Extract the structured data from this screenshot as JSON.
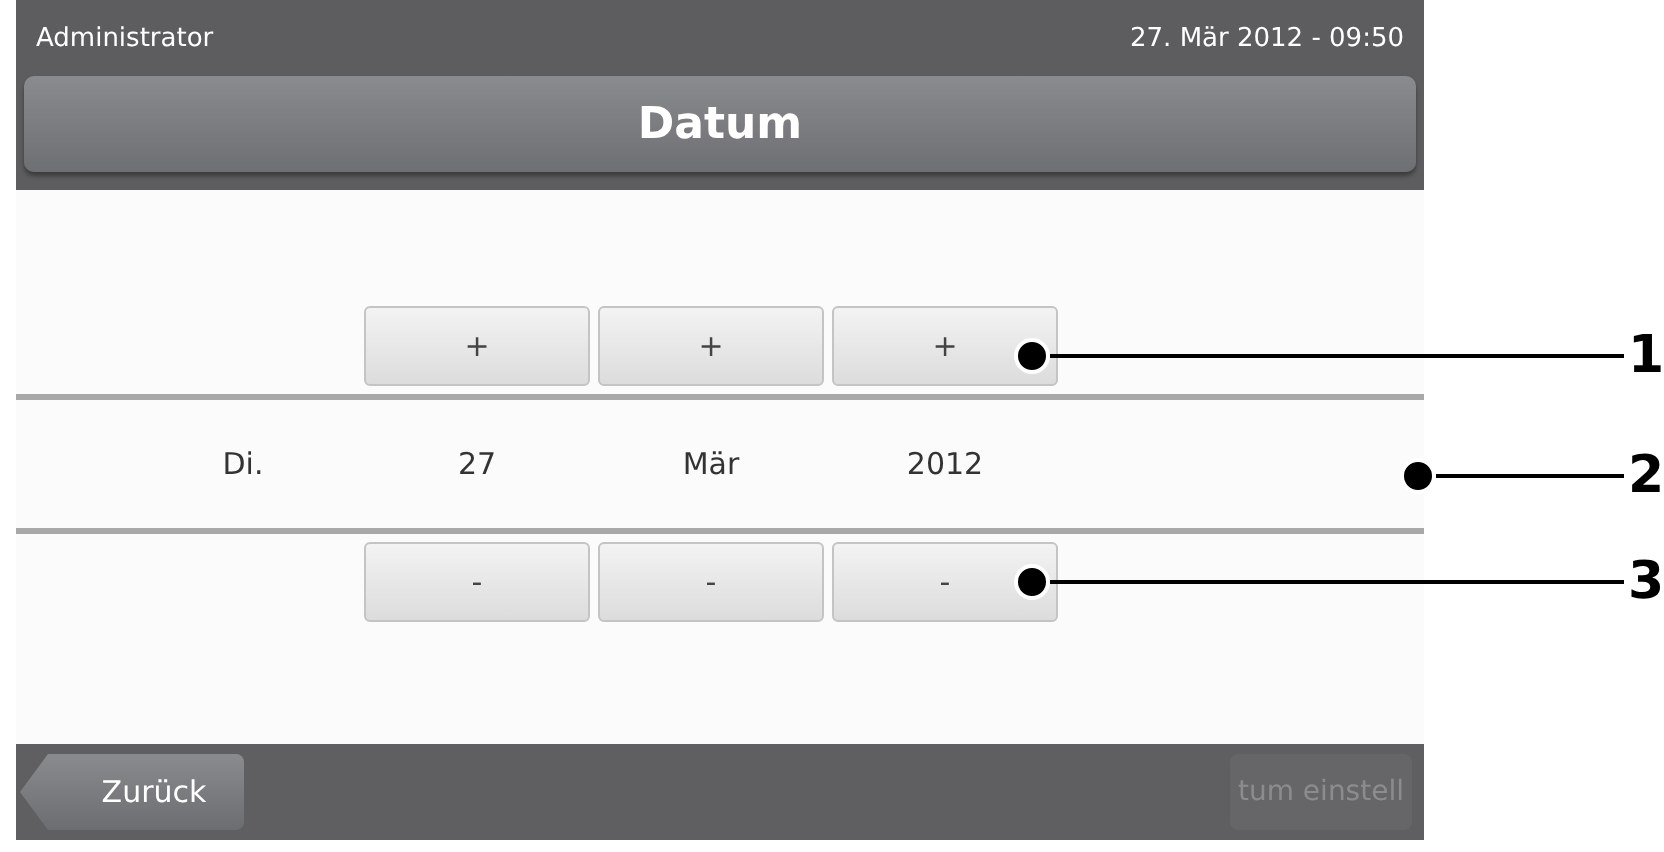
{
  "status_bar": {
    "user": "Administrator",
    "datetime": "27. Mär 2012 - 09:50"
  },
  "title": "Datum",
  "increment_buttons": [
    {
      "label": "+"
    },
    {
      "label": "+"
    },
    {
      "label": "+"
    }
  ],
  "fields": [
    {
      "value": "Di."
    },
    {
      "value": "27"
    },
    {
      "value": "Mär"
    },
    {
      "value": "2012"
    }
  ],
  "decrement_buttons": [
    {
      "label": "-"
    },
    {
      "label": "-"
    },
    {
      "label": "-"
    }
  ],
  "footer": {
    "back_button": {
      "label": "Zurück"
    },
    "action_button": {
      "label": "tum einstell",
      "disabled": true
    }
  },
  "callouts": [
    {
      "number": "1"
    },
    {
      "number": "2"
    },
    {
      "number": "3"
    }
  ]
}
